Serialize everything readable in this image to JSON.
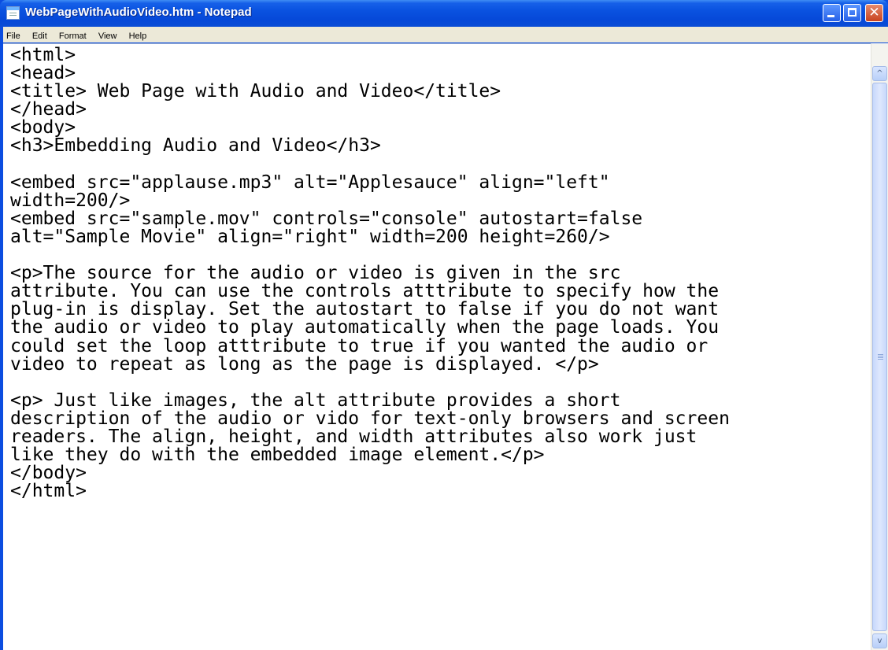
{
  "window": {
    "title": "WebPageWithAudioVideo.htm - Notepad",
    "app_icon": "notepad-icon",
    "controls": {
      "minimize_icon": "minimize-icon",
      "maximize_icon": "maximize-icon",
      "close_icon": "close-icon",
      "close_glyph": "✕"
    }
  },
  "menu": {
    "items": [
      "File",
      "Edit",
      "Format",
      "View",
      "Help"
    ]
  },
  "editor": {
    "content": "<html>\n<head>\n<title> Web Page with Audio and Video</title>\n</head>\n<body>\n<h3>Embedding Audio and Video</h3>\n\n<embed src=\"applause.mp3\" alt=\"Applesauce\" align=\"left\"\nwidth=200/>\n<embed src=\"sample.mov\" controls=\"console\" autostart=false\nalt=\"Sample Movie\" align=\"right\" width=200 height=260/>\n\n<p>The source for the audio or video is given in the src\nattribute. You can use the controls atttribute to specify how the\nplug-in is display. Set the autostart to false if you do not want\nthe audio or video to play automatically when the page loads. You\ncould set the loop atttribute to true if you wanted the audio or\nvideo to repeat as long as the page is displayed. </p>\n\n<p> Just like images, the alt attribute provides a short\ndescription of the audio or vido for text-only browsers and screen\nreaders. The align, height, and width attributes also work just\nlike they do with the embedded image element.</p>\n</body>\n</html>"
  },
  "scrollbar": {
    "up_glyph": "^",
    "down_glyph": "v"
  },
  "colors": {
    "titlebar": "#0a52e0",
    "menubar": "#ece9d8",
    "editor_bg": "#ffffff",
    "close_button": "#c8431f"
  }
}
